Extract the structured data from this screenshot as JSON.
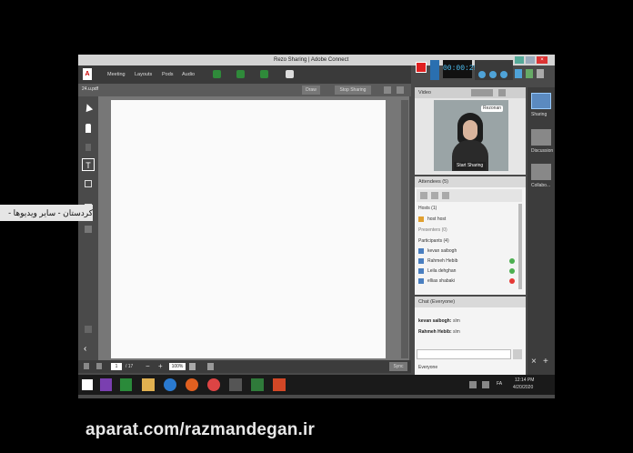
{
  "window": {
    "title": "Rezo Sharing | Adobe Connect",
    "logo_text": "A"
  },
  "menu": {
    "items": [
      "Meeting",
      "Layouts",
      "Pods",
      "Audio"
    ]
  },
  "recording": {
    "timer": "00:00:25"
  },
  "share": {
    "file_name": "24.u.pdf",
    "buttons": {
      "draw": "Draw",
      "stop_sharing": "Stop Sharing"
    },
    "page_current": "1",
    "page_total": "/ 17",
    "zoom": "100%",
    "sync_label": "Sync"
  },
  "video": {
    "title": "Video",
    "name_tag": "Rezonan",
    "start_sharing": "Start Sharing"
  },
  "attendees": {
    "title": "Attendees (5)",
    "host_group": "Hosts (1)",
    "host_name": "host host",
    "presenter_group": "Presenters (0)",
    "participant_group": "Participants (4)",
    "participants": [
      "kevan saibogh",
      "Rahmeh Hebib",
      "Leila dehghan",
      "ellias shabaki"
    ]
  },
  "chat": {
    "title": "Chat (Everyone)",
    "messages": [
      {
        "sender": "kevan saibogh:",
        "text": "slm"
      },
      {
        "sender": "Rahmeh Hebib:",
        "text": "slm"
      }
    ],
    "to_label": "Everyone"
  },
  "rail": {
    "items": [
      "Sharing",
      "Discussion",
      "Collabo..."
    ]
  },
  "taskbar": {
    "time": "12:14 PM",
    "date": "4/20/2020",
    "lang": "FA"
  },
  "overlay": {
    "subtitle": "کردستان - سایر ویدیوها -",
    "watermark": "aparat.com/razmandegan.ir"
  },
  "colors": {
    "accent_green": "#2f8a3a",
    "record_red": "#e02020",
    "taskbar": "#1a1a1a",
    "pod_bg": "#f4f4f4"
  }
}
